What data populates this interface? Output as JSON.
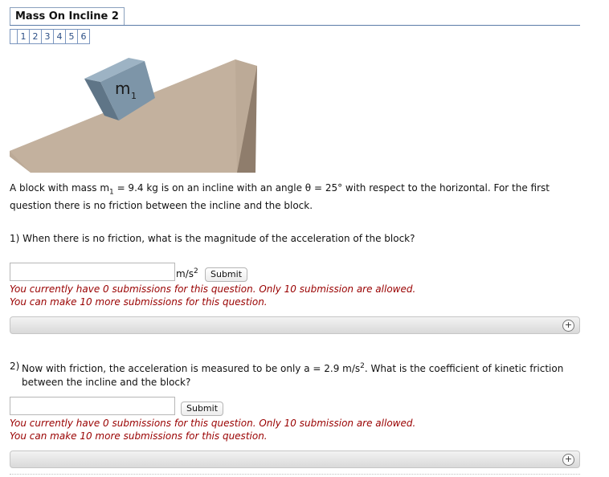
{
  "header": {
    "title": "Mass On Incline 2",
    "pages": [
      "1",
      "2",
      "3",
      "4",
      "5",
      "6"
    ]
  },
  "figure": {
    "block_label": "m",
    "block_label_sub": "1"
  },
  "problem": {
    "text_a": "A block with mass m",
    "sub": "1",
    "text_b": " = 9.4 kg is on an incline with an angle θ = 25° with respect to the horizontal. For the first question there is no friction between the incline and the block."
  },
  "question1": {
    "text": "1) When there is no friction, what is the magnitude of the acceleration of the block?",
    "unit_base": "m/s",
    "unit_exp": "2",
    "submit_label": "Submit",
    "warning_line1": "You currently have 0 submissions for this question. Only 10 submission are allowed.",
    "warning_line2": "You can make 10 more submissions for this question.",
    "expand_symbol": "+"
  },
  "question2": {
    "number": "2)",
    "text_a": "Now with friction, the acceleration is measured to be only a = 2.9 m/s",
    "exp": "2",
    "text_b": ". What is the coefficient of kinetic friction between the incline and the block?",
    "submit_label": "Submit",
    "warning_line1": "You currently have 0 submissions for this question. Only 10 submission are allowed.",
    "warning_line2": "You can make 10 more submissions for this question.",
    "expand_symbol": "+"
  },
  "colors": {
    "incline": "#bcaa97",
    "block": "#7d95a8",
    "warning": "#990000",
    "link": "#2c4f86"
  }
}
